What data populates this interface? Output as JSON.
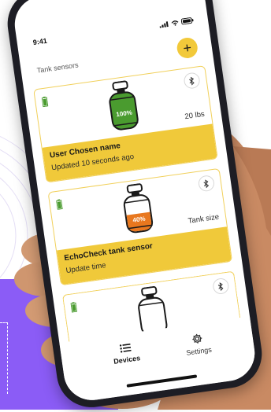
{
  "status_bar": {
    "time": "9:41"
  },
  "header": {
    "title": "Tank sensors",
    "add_button_label": "+"
  },
  "sensors": [
    {
      "name": "User Chosen name",
      "status": "Updated 10 seconds ago",
      "size": "20 lbs",
      "level_label": "100%",
      "level_percent": 100,
      "tank_fill_color": "#4a9b2f"
    },
    {
      "name": "EchoCheck tank sensor",
      "status": "Update time",
      "size": "Tank size",
      "level_label": "40%",
      "level_percent": 40,
      "tank_fill_color": "#e8771e"
    },
    {
      "name": "",
      "status": "",
      "size": "",
      "level_label": "",
      "level_percent": 0,
      "tank_fill_color": "#ffffff"
    }
  ],
  "bottom_nav": {
    "devices_label": "Devices",
    "settings_label": "Settings"
  },
  "icons": {
    "battery": "battery-icon",
    "bluetooth": "bluetooth-icon",
    "tank": "propane-tank-icon",
    "devices": "list-icon",
    "settings": "gear-icon"
  },
  "colors": {
    "accent_yellow": "#f0c93a",
    "card_border": "#f1d05a",
    "purple": "#8b5cf6",
    "battery_green": "#4a9b2f"
  }
}
